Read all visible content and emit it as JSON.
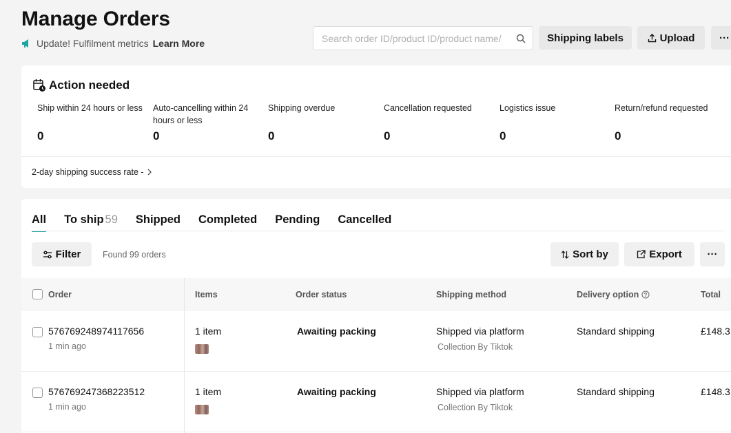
{
  "header": {
    "title": "Manage Orders",
    "update_text": "Update! Fulfilment metrics",
    "learn_more": "Learn More",
    "search_placeholder": "Search order ID/product ID/product name/",
    "shipping_labels": "Shipping labels",
    "upload": "Upload",
    "more": "···"
  },
  "action_needed": {
    "title": "Action needed",
    "metrics": [
      {
        "label": "Ship within 24 hours or less",
        "value": "0"
      },
      {
        "label": "Auto-cancelling within 24 hours or less",
        "value": "0"
      },
      {
        "label": "Shipping overdue",
        "value": "0"
      },
      {
        "label": "Cancellation requested",
        "value": "0"
      },
      {
        "label": "Logistics issue",
        "value": "0"
      },
      {
        "label": "Return/refund requested",
        "value": "0"
      }
    ],
    "success_rate": "2-day shipping success rate -"
  },
  "orders": {
    "tabs": [
      {
        "label": "All",
        "count": ""
      },
      {
        "label": "To ship",
        "count": "59"
      },
      {
        "label": "Shipped",
        "count": ""
      },
      {
        "label": "Completed",
        "count": ""
      },
      {
        "label": "Pending",
        "count": ""
      },
      {
        "label": "Cancelled",
        "count": ""
      }
    ],
    "filter": "Filter",
    "found": "Found 99 orders",
    "sort_by": "Sort by",
    "export": "Export",
    "more": "···",
    "columns": {
      "order": "Order",
      "items": "Items",
      "status": "Order status",
      "shipping": "Shipping method",
      "delivery": "Delivery option",
      "total": "Total"
    },
    "rows": [
      {
        "order_id": "576769248974117656",
        "time": "1 min ago",
        "items": "1 item",
        "status": "Awaiting packing",
        "shipping": "Shipped via platform",
        "shipping_sub": "Collection By Tiktok",
        "delivery": "Standard shipping",
        "total": "£148.3"
      },
      {
        "order_id": "576769247368223512",
        "time": "1 min ago",
        "items": "1 item",
        "status": "Awaiting packing",
        "shipping": "Shipped via platform",
        "shipping_sub": "Collection By Tiktok",
        "delivery": "Standard shipping",
        "total": "£148.3"
      }
    ]
  },
  "colors": {
    "accent": "#1aa5a0",
    "megaphone": "#1aa5a0"
  }
}
